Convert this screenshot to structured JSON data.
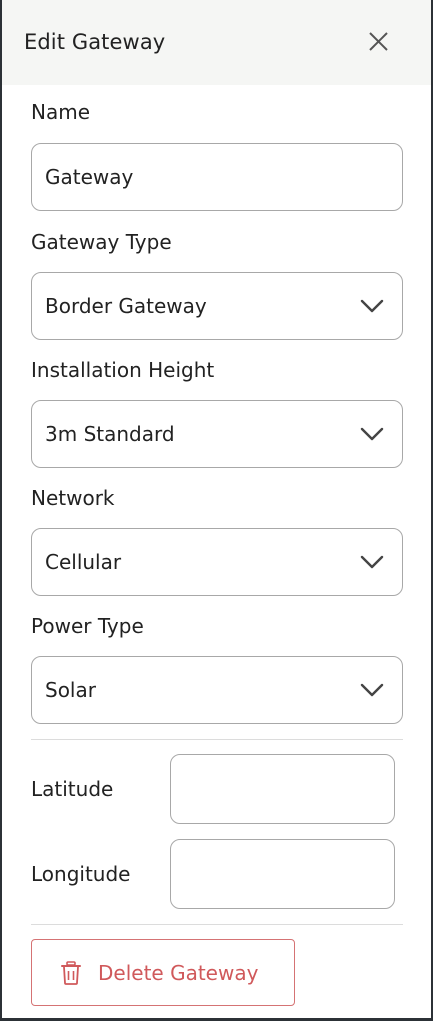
{
  "header": {
    "title": "Edit Gateway",
    "close_icon": "close-icon"
  },
  "form": {
    "name": {
      "label": "Name",
      "value": "Gateway"
    },
    "gateway_type": {
      "label": "Gateway Type",
      "value": "Border Gateway"
    },
    "installation_height": {
      "label": "Installation Height",
      "value": "3m Standard"
    },
    "network": {
      "label": "Network",
      "value": "Cellular"
    },
    "power_type": {
      "label": "Power Type",
      "value": "Solar"
    },
    "latitude": {
      "label": "Latitude",
      "value": ""
    },
    "longitude": {
      "label": "Longitude",
      "value": ""
    }
  },
  "actions": {
    "delete_label": "Delete Gateway",
    "delete_color": "#d0595b"
  },
  "colors": {
    "header_bg": "#f5f6f4",
    "border": "#a8a8a8",
    "danger": "#d0595b"
  }
}
